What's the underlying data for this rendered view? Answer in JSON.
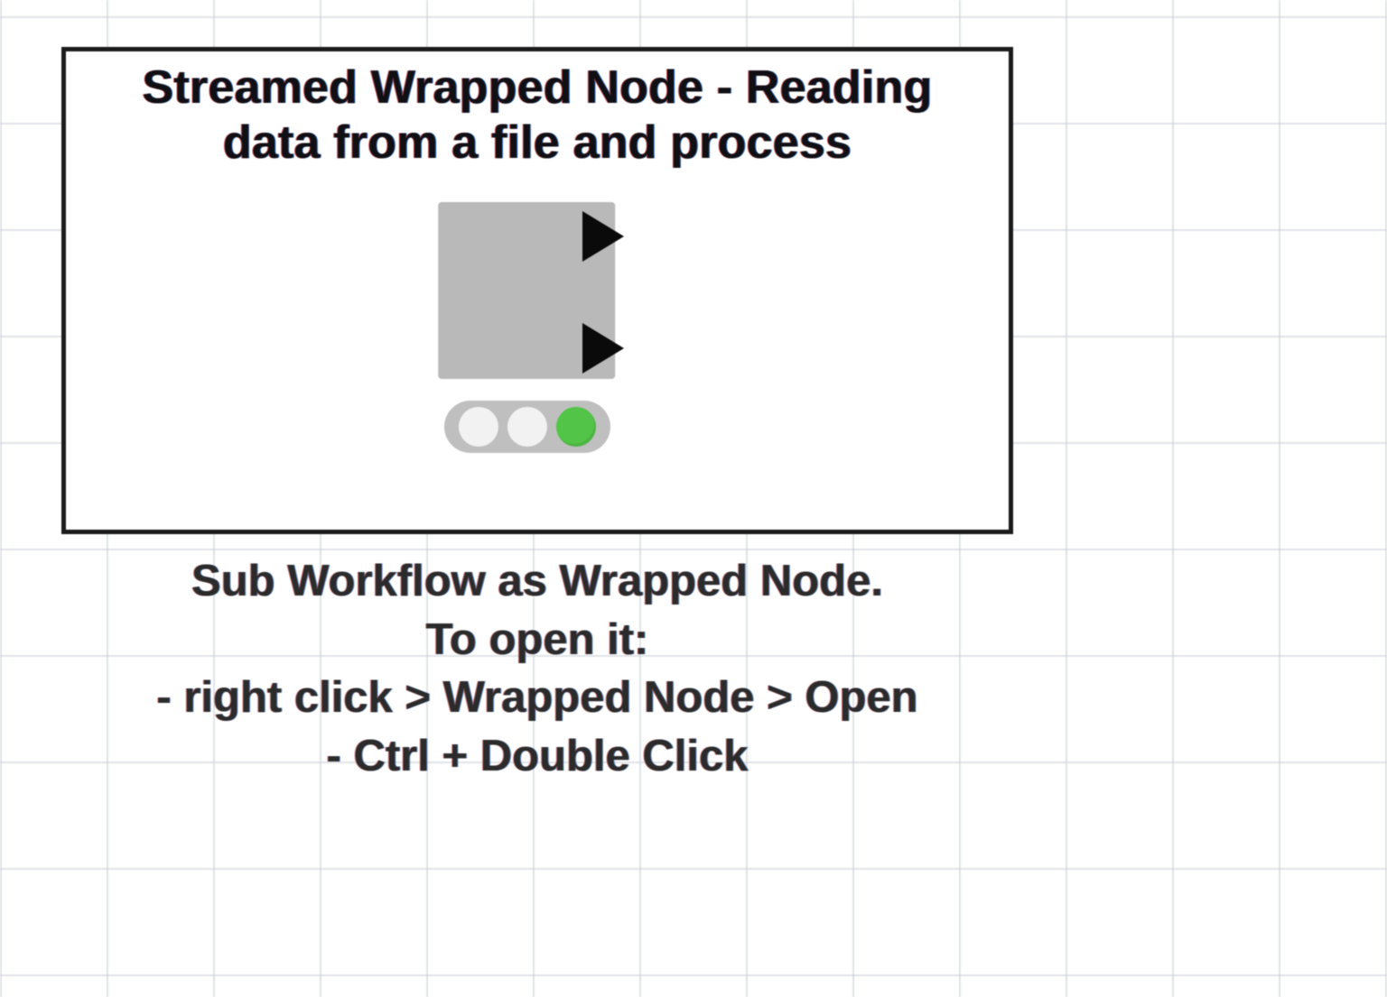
{
  "node": {
    "title_line1": "Streamed Wrapped Node - Reading",
    "title_line2": "data from a file and process",
    "status": {
      "lights": [
        "off",
        "off",
        "on"
      ]
    }
  },
  "caption": {
    "line1": "Sub Workflow as Wrapped Node.",
    "line2": "To open it:",
    "line3": "- right click > Wrapped Node > Open",
    "line4": "- Ctrl + Double Click"
  }
}
